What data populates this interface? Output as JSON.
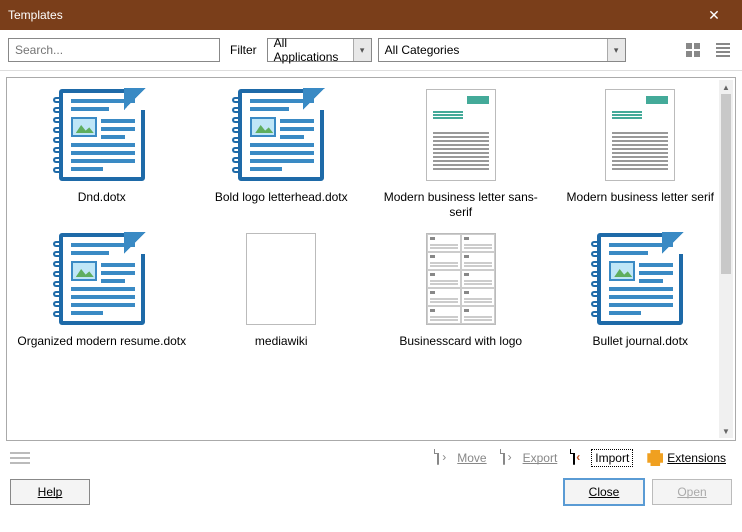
{
  "window": {
    "title": "Templates"
  },
  "toolbar": {
    "search_placeholder": "Search...",
    "filter_label": "Filter",
    "app_select": "All Applications",
    "cat_select": "All Categories"
  },
  "templates": [
    {
      "label": "Dnd.dotx",
      "kind": "docicon"
    },
    {
      "label": "Bold logo letterhead.dotx",
      "kind": "docicon"
    },
    {
      "label": "Modern business letter sans-serif",
      "kind": "letter-sans"
    },
    {
      "label": "Modern business letter serif",
      "kind": "letter-serif"
    },
    {
      "label": "Organized modern resume.dotx",
      "kind": "docicon"
    },
    {
      "label": "mediawiki",
      "kind": "blank"
    },
    {
      "label": "Businesscard with logo",
      "kind": "bcard"
    },
    {
      "label": "Bullet journal.dotx",
      "kind": "docicon"
    }
  ],
  "actions": {
    "move": "Move",
    "export": "Export",
    "import": "Import",
    "extensions": "Extensions"
  },
  "buttons": {
    "help": "Help",
    "close": "Close",
    "open": "Open"
  }
}
